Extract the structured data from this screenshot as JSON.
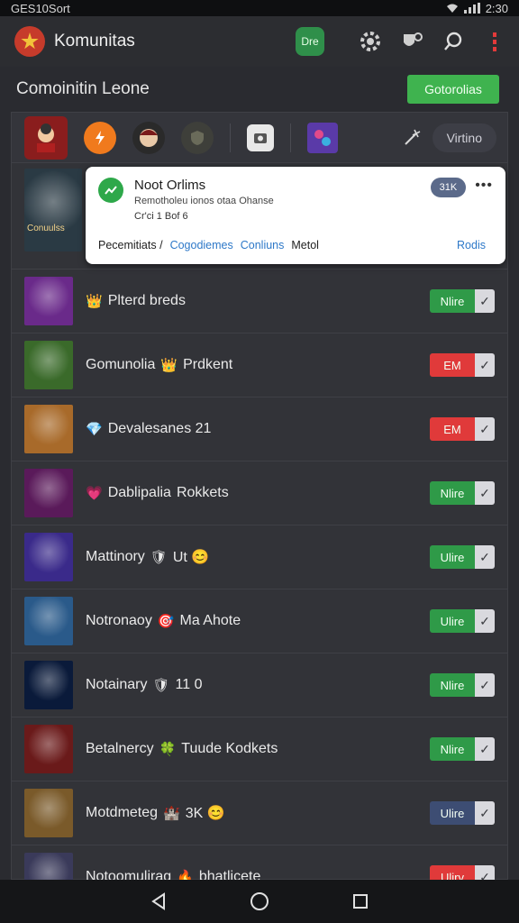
{
  "status": {
    "left": "GES10Sort",
    "time": "2:30"
  },
  "appbar": {
    "title": "Komunitas",
    "chip_label": "Dre"
  },
  "header": {
    "title": "Comoinitin Leone",
    "button_label": "Gotorolias"
  },
  "filters": {
    "pill_label": "Virtino"
  },
  "notification": {
    "title": "Noot Orlims",
    "subtitle": "Remotholeu ionos otaa Ohanse",
    "meta": "Cr'ci  1 Bof 6",
    "pill": "31K",
    "bottom_prefix": "Pecemitiats /",
    "bottom_link1": "Cogodiemes",
    "bottom_link2": "Conliuns",
    "bottom_suffix": "Metol",
    "action": "Rodis",
    "thumb_caption": "Conuulss"
  },
  "rows": [
    {
      "name": "Plterd breds",
      "badge": "👑",
      "badge_after": "",
      "toggle": "Nlire",
      "toggle_color": "#2f9a48"
    },
    {
      "name": "Gomunolia",
      "badge": "👑",
      "badge_after": "Prdkent",
      "toggle": "EM",
      "toggle_color": "#e03a3a"
    },
    {
      "name": "Devalesanes 21",
      "badge": "💎",
      "badge_after": "",
      "toggle": "EM",
      "toggle_color": "#e03a3a"
    },
    {
      "name": "Dablipalia",
      "badge": "💗",
      "badge_after": "Rokkets",
      "toggle": "Nlire",
      "toggle_color": "#2f9a48"
    },
    {
      "name": "Mattinory",
      "badge": "🛡",
      "badge_after": "Ut 😊",
      "toggle": "Ulire",
      "toggle_color": "#2f9a48"
    },
    {
      "name": "Notronaoy",
      "badge": "🎯",
      "badge_after": "Ma Ahote",
      "toggle": "Ulire",
      "toggle_color": "#2f9a48"
    },
    {
      "name": "Notainary",
      "badge": "🛡",
      "badge_after": "11 0",
      "toggle": "Nlire",
      "toggle_color": "#2f9a48"
    },
    {
      "name": "Betalnercy",
      "badge": "🍀",
      "badge_after": "Tuude Kodkets",
      "toggle": "Nlire",
      "toggle_color": "#2f9a48"
    },
    {
      "name": "Motdmeteg",
      "badge": "🏰",
      "badge_after": "3K 😊",
      "toggle": "Ulire",
      "toggle_color": "#3d4d73"
    },
    {
      "name": "Notoomulirag",
      "badge": "🔥",
      "badge_after": "bhatlicete",
      "toggle": "Ulirv",
      "toggle_color": "#e03a3a"
    }
  ],
  "thumb_colors": [
    "#6a2a8a",
    "#3a6a2a",
    "#a86a2a",
    "#5a1a5a",
    "#3a2a8a",
    "#2a5a8a",
    "#0a1a3a",
    "#6a1a1a",
    "#7a5a2a",
    "#3a3a5a"
  ],
  "icons": [
    "signal-icon",
    "wifi-icon",
    "gear-icon",
    "badge-icon",
    "search-icon",
    "more-icon",
    "back-icon",
    "home-icon",
    "recents-icon"
  ]
}
